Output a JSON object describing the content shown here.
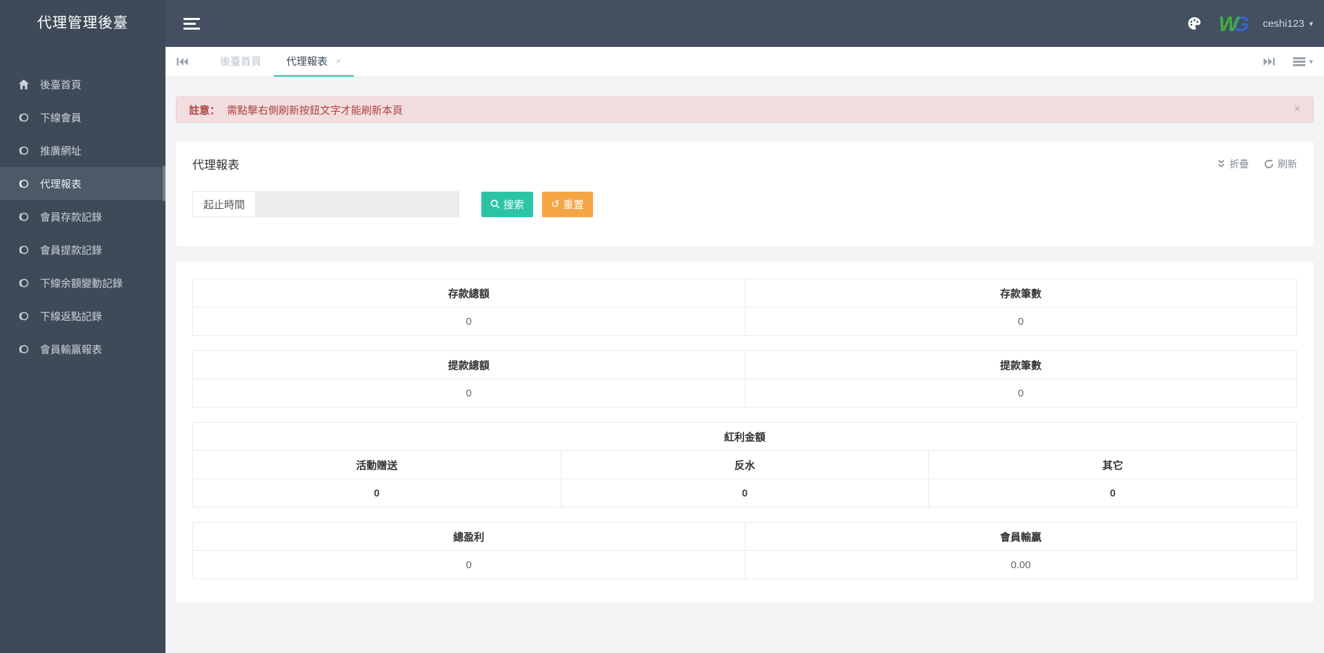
{
  "app": {
    "title": "代理管理後臺"
  },
  "navbar": {
    "username": "ceshi123",
    "caret": "▾",
    "logo": {
      "w": "W",
      "g": "G",
      "w_color": "#3fae3e",
      "g_color": "#3a62c8"
    }
  },
  "sidebar": {
    "items": [
      {
        "id": "home",
        "label": "後臺首頁",
        "icon": "home-icon",
        "active": false
      },
      {
        "id": "downline-members",
        "label": "下線會員",
        "icon": "circle-icon",
        "active": false
      },
      {
        "id": "promo-url",
        "label": "推廣網址",
        "icon": "circle-icon",
        "active": false
      },
      {
        "id": "agent-report",
        "label": "代理報表",
        "icon": "circle-icon",
        "active": true
      },
      {
        "id": "member-deposit-records",
        "label": "會員存款記錄",
        "icon": "circle-icon",
        "active": false
      },
      {
        "id": "member-withdraw-records",
        "label": "會員提款記錄",
        "icon": "circle-icon",
        "active": false
      },
      {
        "id": "downline-balance-change-records",
        "label": "下線余額變動記錄",
        "icon": "circle-icon",
        "active": false
      },
      {
        "id": "downline-rebate-records",
        "label": "下線返點記錄",
        "icon": "circle-icon",
        "active": false
      },
      {
        "id": "member-winloss-report",
        "label": "會員輸贏報表",
        "icon": "circle-icon",
        "active": false
      }
    ]
  },
  "tabbar": {
    "tabs": [
      {
        "id": "home",
        "label": "後臺首頁",
        "active": false,
        "closable": false
      },
      {
        "id": "agent-report",
        "label": "代理報表",
        "active": true,
        "closable": true
      }
    ],
    "close_symbol": "×"
  },
  "alert": {
    "prefix": "註意：",
    "message": "需點擊右側刷新按鈕文字才能刷新本頁",
    "close": "×"
  },
  "panel": {
    "title": "代理報表",
    "collapse_label": "折疊",
    "refresh_label": "刷新"
  },
  "form": {
    "date_label": "起止時間",
    "date_value": "",
    "search_label": "搜索",
    "reset_label": "重置",
    "reset_glyph": "↺"
  },
  "report_tables": [
    {
      "id": "deposit",
      "span_header": null,
      "headers": [
        "存款總額",
        "存款筆數"
      ],
      "values": [
        "0",
        "0"
      ],
      "bold_values": false
    },
    {
      "id": "withdraw",
      "span_header": null,
      "headers": [
        "提款總額",
        "提款筆數"
      ],
      "values": [
        "0",
        "0"
      ],
      "bold_values": false
    },
    {
      "id": "bonus",
      "span_header": "紅利金額",
      "headers": [
        "活動贈送",
        "反水",
        "其它"
      ],
      "values": [
        "0",
        "0",
        "0"
      ],
      "bold_values": true
    },
    {
      "id": "profit",
      "span_header": null,
      "headers": [
        "總盈利",
        "會員輸贏"
      ],
      "values": [
        "0",
        "0.00"
      ],
      "bold_values": false
    }
  ],
  "colors": {
    "sidebar_bg": "#3e4a58",
    "sidebar_active_bg": "#4c5967",
    "navbar_bg": "#445061",
    "accent_teal": "#2bc5a6",
    "warning_orange": "#f5a644",
    "alert_bg": "#f2dede",
    "alert_text": "#a94442",
    "content_bg": "#f2f4f6"
  }
}
